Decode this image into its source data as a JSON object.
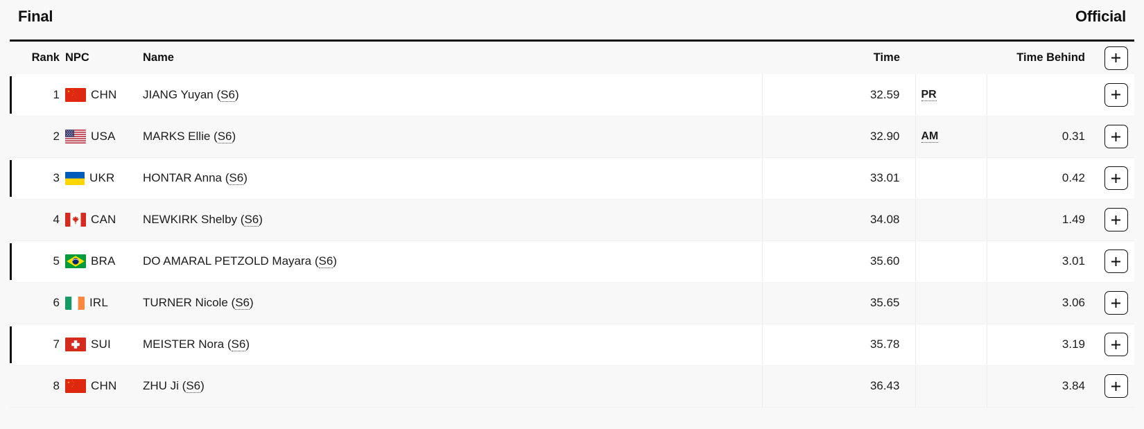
{
  "header": {
    "title": "Final",
    "status": "Official"
  },
  "table": {
    "columns": {
      "rank": "Rank",
      "npc": "NPC",
      "rank_npc": "Rank NPC",
      "name": "Name",
      "time": "Time",
      "record": "",
      "time_behind": "Time Behind",
      "expand": "+"
    },
    "expand_icon": "plus-icon",
    "rows": [
      {
        "rank": "1",
        "npc": "CHN",
        "flag": "china-flag",
        "name": "JIANG Yuyan",
        "classification": "S6",
        "time": "32.59",
        "record": "PR",
        "time_behind": "",
        "expand": "+"
      },
      {
        "rank": "2",
        "npc": "USA",
        "flag": "usa-flag",
        "name": "MARKS Ellie",
        "classification": "S6",
        "time": "32.90",
        "record": "AM",
        "time_behind": "0.31",
        "expand": "+"
      },
      {
        "rank": "3",
        "npc": "UKR",
        "flag": "ukraine-flag",
        "name": "HONTAR Anna",
        "classification": "S6",
        "time": "33.01",
        "record": "",
        "time_behind": "0.42",
        "expand": "+"
      },
      {
        "rank": "4",
        "npc": "CAN",
        "flag": "canada-flag",
        "name": "NEWKIRK Shelby",
        "classification": "S6",
        "time": "34.08",
        "record": "",
        "time_behind": "1.49",
        "expand": "+"
      },
      {
        "rank": "5",
        "npc": "BRA",
        "flag": "brazil-flag",
        "name": "DO AMARAL PETZOLD Mayara",
        "classification": "S6",
        "time": "35.60",
        "record": "",
        "time_behind": "3.01",
        "expand": "+"
      },
      {
        "rank": "6",
        "npc": "IRL",
        "flag": "ireland-flag",
        "name": "TURNER Nicole",
        "classification": "S6",
        "time": "35.65",
        "record": "",
        "time_behind": "3.06",
        "expand": "+"
      },
      {
        "rank": "7",
        "npc": "SUI",
        "flag": "switzerland-flag",
        "name": "MEISTER Nora",
        "classification": "S6",
        "time": "35.78",
        "record": "",
        "time_behind": "3.19",
        "expand": "+"
      },
      {
        "rank": "8",
        "npc": "CHN",
        "flag": "china-flag",
        "name": "ZHU Ji",
        "classification": "S6",
        "time": "36.43",
        "record": "",
        "time_behind": "3.84",
        "expand": "+"
      }
    ]
  },
  "colors": {
    "text": "#111111",
    "row_odd_bg": "#ffffff",
    "row_even_bg": "#f8f8f8",
    "accent_bar": "#111111",
    "page_bg": "#f8f8f8"
  }
}
